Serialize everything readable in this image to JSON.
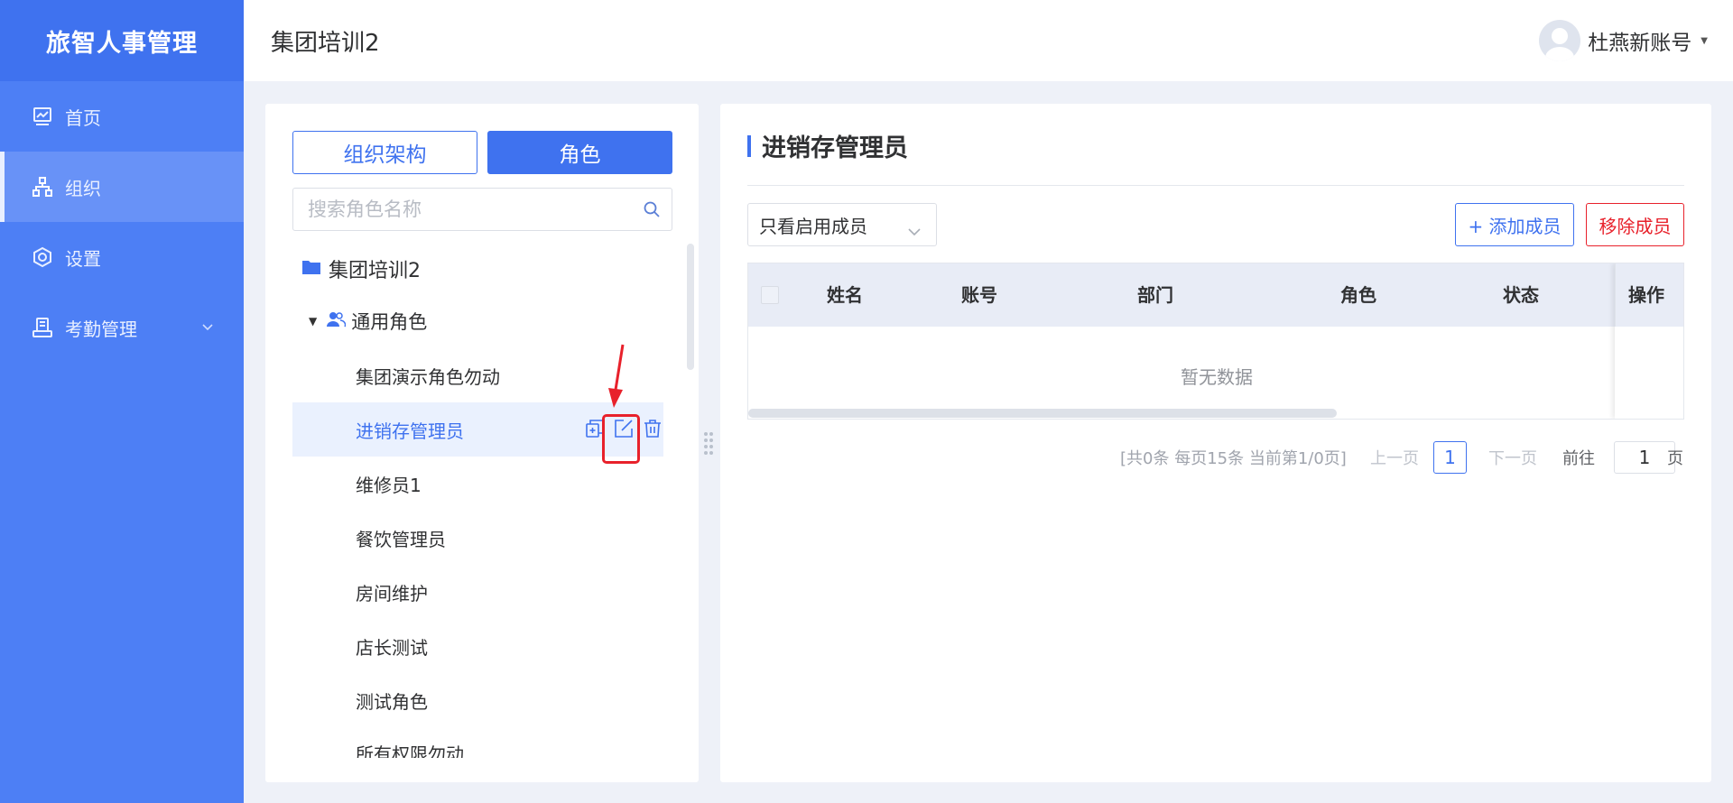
{
  "app": {
    "brand": "旅智人事管理"
  },
  "sidebar": {
    "items": [
      {
        "label": "首页",
        "icon": "chart-icon",
        "active": false
      },
      {
        "label": "组织",
        "icon": "org-icon",
        "active": true
      },
      {
        "label": "设置",
        "icon": "settings-icon",
        "active": false
      },
      {
        "label": "考勤管理",
        "icon": "attendance-icon",
        "active": false,
        "expandable": true
      }
    ]
  },
  "header": {
    "title": "集团培训2",
    "user": "杜燕新账号"
  },
  "left_panel": {
    "tabs": [
      {
        "label": "组织架构",
        "active": false
      },
      {
        "label": "角色",
        "active": true
      }
    ],
    "search_placeholder": "搜索角色名称",
    "tree_root": "集团培训2",
    "group": "通用角色",
    "roles": [
      "集团演示角色勿动",
      "进销存管理员",
      "维修员1",
      "餐饮管理员",
      "房间维护",
      "店长测试",
      "测试角色",
      "所有权限勿动"
    ],
    "selected_role_index": 1
  },
  "right_panel": {
    "title": "进销存管理员",
    "filter": "只看启用成员",
    "add_button": "+ 添加成员",
    "remove_button": "移除成员",
    "table": {
      "columns": [
        "姓名",
        "账号",
        "部门",
        "角色",
        "状态",
        "操作"
      ],
      "empty_text": "暂无数据"
    },
    "pagination": {
      "info": "[共0条 每页15条 当前第1/0页]",
      "prev": "上一页",
      "current": "1",
      "next": "下一页",
      "goto": "前往",
      "goto_value": "1",
      "unit": "页"
    }
  },
  "colors": {
    "primary": "#3f72ef",
    "sidebar": "#4d7ff5",
    "danger": "#e8212b"
  }
}
